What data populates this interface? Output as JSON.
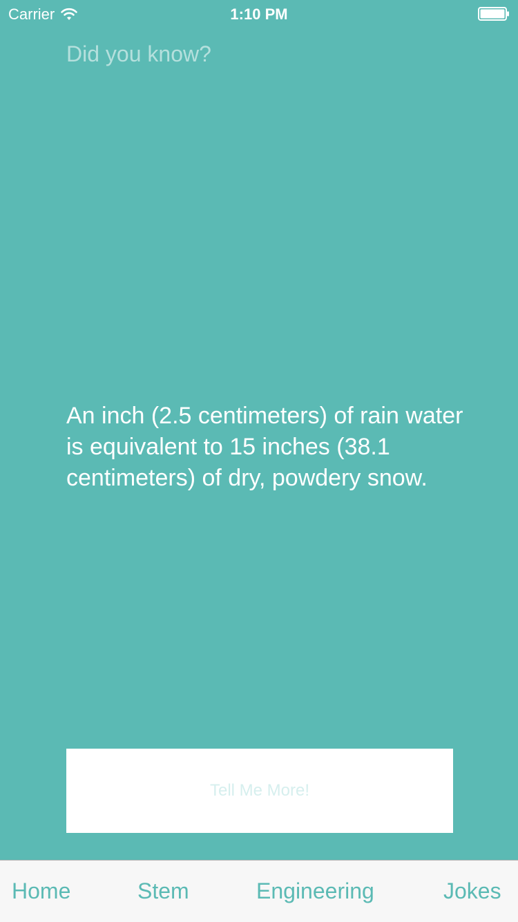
{
  "status_bar": {
    "carrier": "Carrier",
    "time": "1:10 PM",
    "wifi_icon": "wifi-icon",
    "battery_icon": "battery-icon"
  },
  "main": {
    "heading": "Did you know?",
    "fact": "An inch (2.5 centimeters) of rain water is equivalent to 15 inches (38.1 centimeters) of dry, powdery snow.",
    "button_label": "Tell Me More!"
  },
  "tabs": [
    {
      "label": "Home"
    },
    {
      "label": "Stem"
    },
    {
      "label": "Engineering"
    },
    {
      "label": "Jokes"
    }
  ],
  "colors": {
    "background": "#5bbab4",
    "accent": "#5bbab4",
    "tab_bar_bg": "#f7f7f7",
    "button_bg": "#ffffff"
  }
}
